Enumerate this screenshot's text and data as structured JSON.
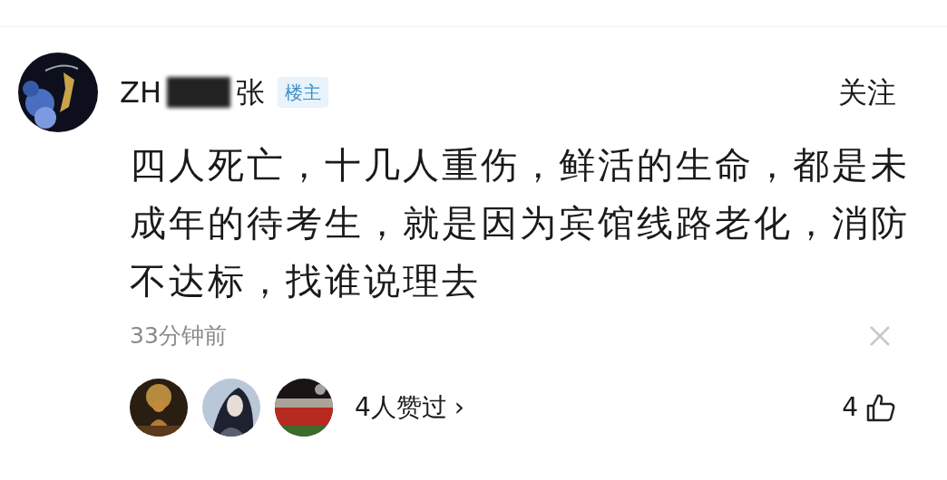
{
  "comment": {
    "author": {
      "name_start": "ZH",
      "name_end": "张",
      "badge": "楼主"
    },
    "follow": "关注",
    "text": "四人死亡，十几人重伤，鲜活的生命，都是未成年的待考生，就是因为宾馆线路老化，消防不达标，找谁说理去",
    "time": "33分钟前",
    "likers_text": "4人赞过",
    "chevron": "›",
    "like_count": "4"
  }
}
